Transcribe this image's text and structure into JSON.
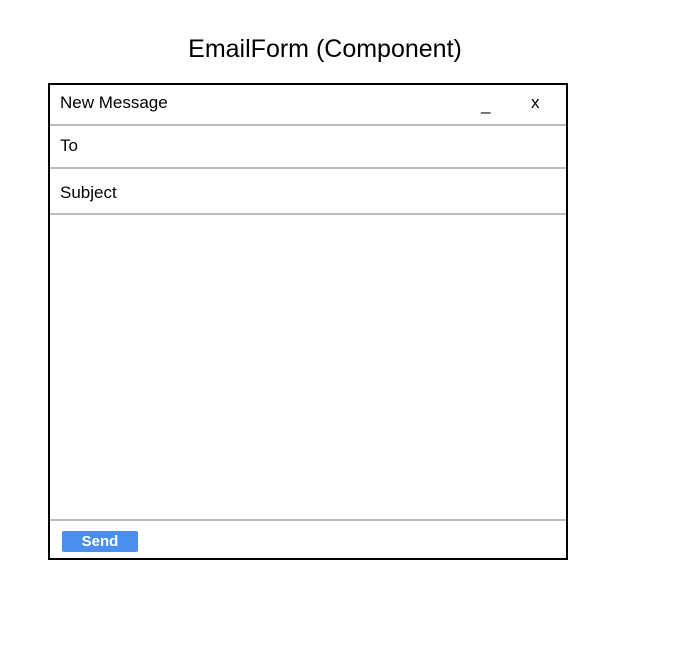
{
  "page": {
    "title": "EmailForm (Component)"
  },
  "window": {
    "title": "New Message",
    "minimize_label": "_",
    "close_label": "x"
  },
  "fields": {
    "to_label": "To",
    "subject_label": "Subject",
    "body_value": ""
  },
  "footer": {
    "send_label": "Send"
  },
  "colors": {
    "send_button": "#4a8ef0",
    "divider": "#bdbdbd",
    "border": "#000000"
  }
}
